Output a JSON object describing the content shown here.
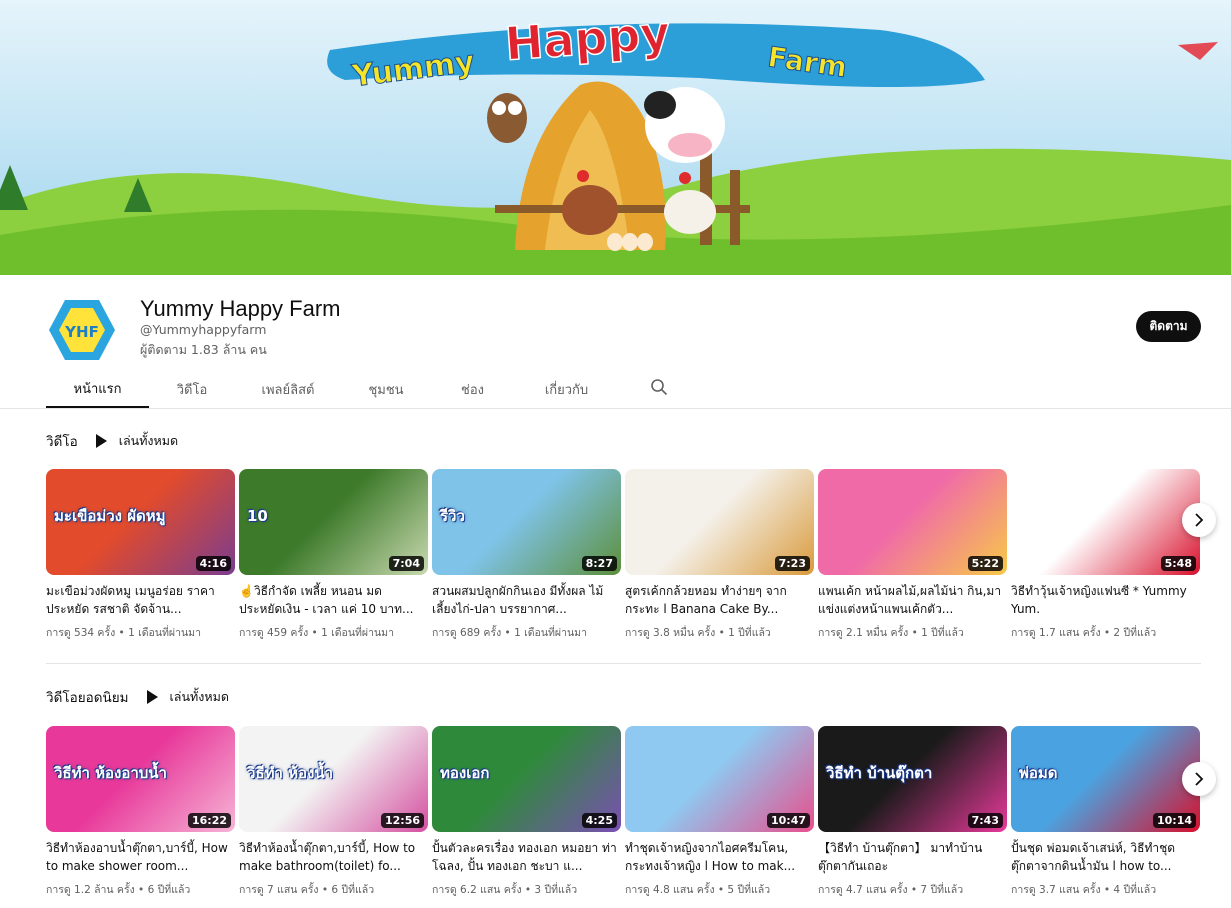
{
  "banner": {
    "title_word1": "Yummy",
    "title_word2": "Happy",
    "title_word3": "Farm"
  },
  "channel": {
    "name": "Yummy Happy Farm",
    "handle": "@Yummyhappyfarm",
    "subscribers": "ผู้ติดตาม 1.83 ล้าน คน",
    "subscribe_label": "ติดตาม",
    "avatar_text": "YHF"
  },
  "tabs": [
    {
      "label": "หน้าแรก"
    },
    {
      "label": "วิดีโอ"
    },
    {
      "label": "เพลย์ลิสต์"
    },
    {
      "label": "ชุมชน"
    },
    {
      "label": "ช่อง"
    },
    {
      "label": "เกี่ยวกับ"
    }
  ],
  "sections": [
    {
      "title": "วิดีโอ",
      "play_all": "เล่นทั้งหมด",
      "videos": [
        {
          "title": "มะเขือม่วงผัดหมู เมนูอร่อย ราคาประหยัด รสชาติ จัดจ้าน...",
          "meta": "การดู 534 ครั้ง • 1 เดือนที่ผ่านมา",
          "duration": "4:16",
          "thumb_text": "มะเขือม่วง ผัดหมู",
          "color1": "#e24b2c",
          "color2": "#7a3d8f"
        },
        {
          "title": "☝️วิธีกำจัด เพลี้ย หนอน มด ประหยัดเงิน - เวลา แค่ 10 บาท...",
          "meta": "การดู 459 ครั้ง • 1 เดือนที่ผ่านมา",
          "duration": "7:04",
          "thumb_text": "10",
          "color1": "#3d7a2a",
          "color2": "#c9d9b0"
        },
        {
          "title": "สวนผสมปลูกผักกินเอง มีทั้งผล ไม้ เลี้ยงไก่-ปลา บรรยากาศ...",
          "meta": "การดู 689 ครั้ง • 1 เดือนที่ผ่านมา",
          "duration": "8:27",
          "thumb_text": "รีวิว",
          "color1": "#7fc3e8",
          "color2": "#5d8f3a"
        },
        {
          "title": "สูตรเค้กกล้วยหอม ทำง่ายๆ จาก กระทะ l Banana Cake By...",
          "meta": "การดู 3.8 หมื่น ครั้ง • 1 ปีที่แล้ว",
          "duration": "7:23",
          "thumb_text": "",
          "color1": "#f4f1ea",
          "color2": "#d99a3b"
        },
        {
          "title": "แพนเค้ก หน้าผลไม้,ผลไม้น่า กิน,มาแข่งแต่งหน้าแพนเค้กตัว...",
          "meta": "การดู 2.1 หมื่น ครั้ง • 1 ปีที่แล้ว",
          "duration": "5:22",
          "thumb_text": "",
          "color1": "#f06aa8",
          "color2": "#f7c948"
        },
        {
          "title": "วิธีทำวุ้นเจ้าหญิงแฟนซี * Yummy Yum.",
          "meta": "การดู 1.7 แสน ครั้ง • 2 ปีที่แล้ว",
          "duration": "5:48",
          "thumb_text": "",
          "color1": "#ffffff",
          "color2": "#d8102c"
        }
      ]
    },
    {
      "title": "วิดีโอยอดนิยม",
      "play_all": "เล่นทั้งหมด",
      "videos": [
        {
          "title": "วิธีทำห้องอาบน้ำตุ๊กตา,บาร์บี้, How to make shower room...",
          "meta": "การดู 1.2 ล้าน ครั้ง • 6 ปีที่แล้ว",
          "duration": "16:22",
          "thumb_text": "วิธีทำ ห้องอาบน้ำ",
          "color1": "#e8399a",
          "color2": "#f6b5d6"
        },
        {
          "title": "วิธีทำห้องน้ำตุ๊กตา,บาร์บี้, How to make bathroom(toilet) fo...",
          "meta": "การดู 7 แสน ครั้ง • 6 ปีที่แล้ว",
          "duration": "12:56",
          "thumb_text": "วิธีทำ ห้องน้ำ",
          "color1": "#f3f3f3",
          "color2": "#d44fa0"
        },
        {
          "title": "ปั้นตัวละครเรื่อง ทองเอก หมอยา ท่าโฉลง, ปั้น ทองเอก ชะบา แ...",
          "meta": "การดู 6.2 แสน ครั้ง • 3 ปีที่แล้ว",
          "duration": "4:25",
          "thumb_text": "ทองเอก",
          "color1": "#2e8a3a",
          "color2": "#7b4fb3"
        },
        {
          "title": "ทำชุดเจ้าหญิงจากไอศครีมโคน, กระทงเจ้าหญิง l How to mak...",
          "meta": "การดู 4.8 แสน ครั้ง • 5 ปีที่แล้ว",
          "duration": "10:47",
          "thumb_text": "",
          "color1": "#8fc8f0",
          "color2": "#e84f8c"
        },
        {
          "title": "【วิธีทำ บ้านตุ๊กตา】 มาทำบ้าน ตุ๊กตากันเถอะ",
          "meta": "การดู 4.7 แสน ครั้ง • 7 ปีที่แล้ว",
          "duration": "7:43",
          "thumb_text": "วิธีทำ บ้านตุ๊กตา",
          "color1": "#1a1a1a",
          "color2": "#e8399a"
        },
        {
          "title": "ปั้นชุด พ่อมดเจ้าเสน่ห์, วิธีทำชุด ตุ๊กตาจากดินน้ำมัน l how to...",
          "meta": "การดู 3.7 แสน ครั้ง • 4 ปีที่แล้ว",
          "duration": "10:14",
          "thumb_text": "พ่อมด",
          "color1": "#4aa3e0",
          "color2": "#d8102c"
        }
      ]
    }
  ],
  "colors": {
    "accent": "#0f0f0f",
    "secondary_text": "#606060",
    "divider": "#e5e5e5"
  }
}
